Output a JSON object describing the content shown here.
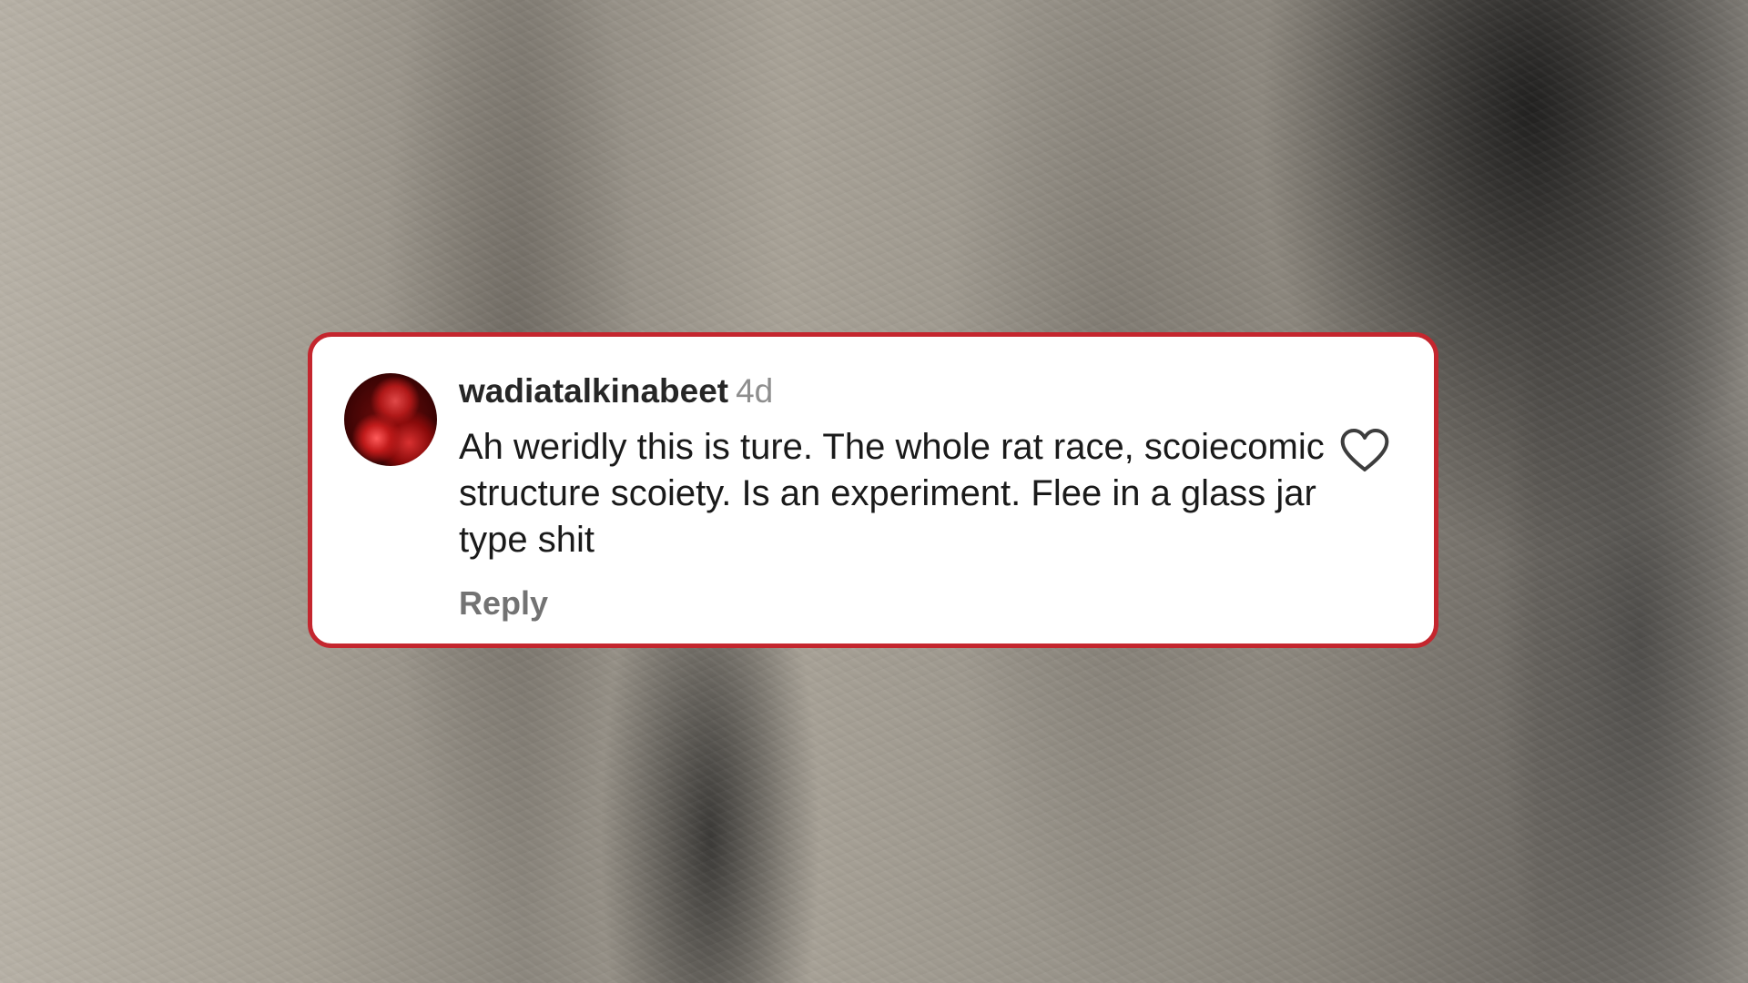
{
  "comment": {
    "username": "wadiatalkinabeet",
    "timestamp": "4d",
    "text": "Ah weridly this is ture. The whole rat race, scoiecomic structure scoiety. Is an experiment. Flee in a glass jar type shit",
    "reply_label": "Reply",
    "like_icon": "heart-icon"
  },
  "colors": {
    "card_border": "#c4262e",
    "card_background": "#ffffff",
    "username": "#262626",
    "timestamp": "#8e8e8e",
    "reply": "#737373"
  }
}
